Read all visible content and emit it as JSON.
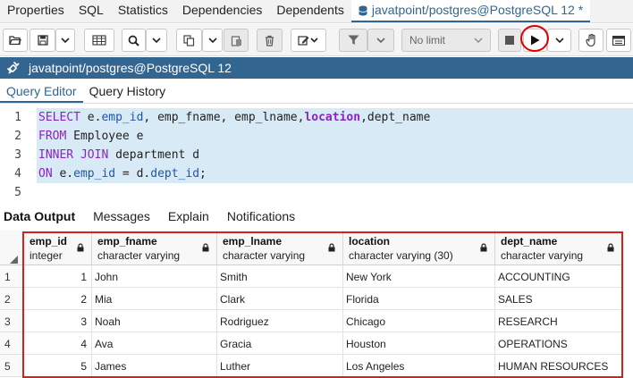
{
  "top_tabs": [
    "Properties",
    "SQL",
    "Statistics",
    "Dependencies",
    "Dependents"
  ],
  "query_tab_title": "javatpoint/postgres@PostgreSQL 12 *",
  "toolbar": {
    "limit_value": "No limit"
  },
  "connection": {
    "label": "javatpoint/postgres@PostgreSQL 12"
  },
  "editor_tabs": [
    "Query Editor",
    "Query History"
  ],
  "code": {
    "line_numbers": [
      "1",
      "2",
      "3",
      "4",
      "5"
    ],
    "l1": {
      "kw": "SELECT",
      "t1": " e.",
      "f1": "emp_id",
      "t2": ", emp_fname, emp_lname,",
      "kw2": "location",
      "t3": ",dept_name"
    },
    "l2": {
      "kw": "FROM",
      "t1": " Employee e"
    },
    "l3": {
      "kw": "INNER JOIN",
      "t1": " department d"
    },
    "l4": {
      "kw": "ON",
      "t1": " e.",
      "f1": "emp_id",
      "t2": " = d.",
      "f2": "dept_id",
      "t3": ";"
    }
  },
  "output_tabs": [
    "Data Output",
    "Messages",
    "Explain",
    "Notifications"
  ],
  "columns": [
    {
      "name": "emp_id",
      "type": "integer"
    },
    {
      "name": "emp_fname",
      "type": "character varying"
    },
    {
      "name": "emp_lname",
      "type": "character varying"
    },
    {
      "name": "location",
      "type": "character varying (30)"
    },
    {
      "name": "dept_name",
      "type": "character varying"
    }
  ],
  "rows": [
    {
      "n": "1",
      "emp_id": "1",
      "emp_fname": "John",
      "emp_lname": "Smith",
      "location": "New York",
      "dept_name": "ACCOUNTING"
    },
    {
      "n": "2",
      "emp_id": "2",
      "emp_fname": "Mia",
      "emp_lname": "Clark",
      "location": "Florida",
      "dept_name": "SALES"
    },
    {
      "n": "3",
      "emp_id": "3",
      "emp_fname": "Noah",
      "emp_lname": "Rodriguez",
      "location": "Chicago",
      "dept_name": "RESEARCH"
    },
    {
      "n": "4",
      "emp_id": "4",
      "emp_fname": "Ava",
      "emp_lname": "Gracia",
      "location": "Houston",
      "dept_name": "OPERATIONS"
    },
    {
      "n": "5",
      "emp_id": "5",
      "emp_fname": "James",
      "emp_lname": "Luther",
      "location": "Los Angeles",
      "dept_name": "HUMAN RESOURCES"
    }
  ],
  "colors": {
    "brand": "#326690",
    "keyword": "#8a23c2",
    "field": "#2255a6",
    "highlight": "#d8eaf6",
    "annotation": "#d62020"
  },
  "icons": [
    "database-icon",
    "folder-open-icon",
    "save-icon",
    "chevron-down-icon",
    "table-icon",
    "search-icon",
    "copy-icon",
    "paste-icon",
    "delete-icon",
    "edit-icon",
    "filter-icon",
    "stop-icon",
    "play-icon",
    "hand-icon",
    "grid-icon",
    "connection-icon",
    "lock-icon"
  ]
}
